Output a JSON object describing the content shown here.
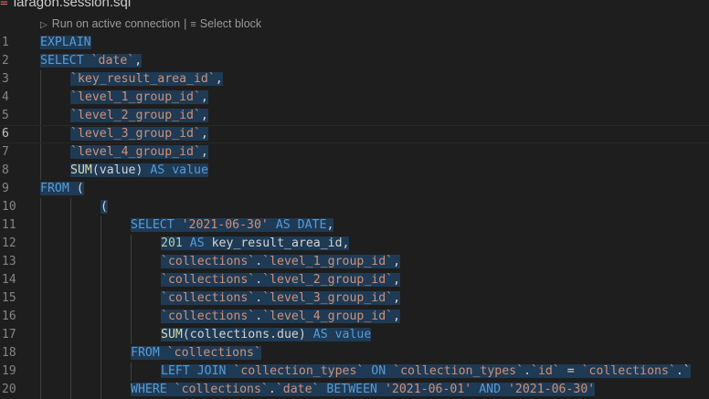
{
  "tab": {
    "filename": "laragon.session.sql"
  },
  "codelens": {
    "run_label": "Run on active connection",
    "separator": "|",
    "select_label": "Select block"
  },
  "lines": [
    {
      "n": "1",
      "indent": 0,
      "tokens": [
        {
          "t": "kw",
          "v": "EXPLAIN"
        }
      ]
    },
    {
      "n": "2",
      "indent": 0,
      "tokens": [
        {
          "t": "kw",
          "v": "SELECT"
        },
        {
          "t": "plain",
          "v": " "
        },
        {
          "t": "str",
          "v": "`date`"
        },
        {
          "t": "plain",
          "v": ","
        }
      ]
    },
    {
      "n": "3",
      "indent": 1,
      "tokens": [
        {
          "t": "str",
          "v": "`key_result_area_id`"
        },
        {
          "t": "plain",
          "v": ","
        }
      ]
    },
    {
      "n": "4",
      "indent": 1,
      "tokens": [
        {
          "t": "str",
          "v": "`level_1_group_id`"
        },
        {
          "t": "plain",
          "v": ","
        }
      ]
    },
    {
      "n": "5",
      "indent": 1,
      "tokens": [
        {
          "t": "str",
          "v": "`level_2_group_id`"
        },
        {
          "t": "plain",
          "v": ","
        }
      ]
    },
    {
      "n": "6",
      "indent": 1,
      "active": true,
      "tokens": [
        {
          "t": "str",
          "v": "`level_3_group_id`"
        },
        {
          "t": "plain",
          "v": ","
        }
      ]
    },
    {
      "n": "7",
      "indent": 1,
      "tokens": [
        {
          "t": "str",
          "v": "`level_4_group_id`"
        },
        {
          "t": "plain",
          "v": ","
        }
      ]
    },
    {
      "n": "8",
      "indent": 1,
      "tokens": [
        {
          "t": "fn",
          "v": "SUM"
        },
        {
          "t": "plain",
          "v": "(value) "
        },
        {
          "t": "kw",
          "v": "AS"
        },
        {
          "t": "plain",
          "v": " "
        },
        {
          "t": "kw",
          "v": "value"
        }
      ]
    },
    {
      "n": "9",
      "indent": 0,
      "tokens": [
        {
          "t": "kw",
          "v": "FROM"
        },
        {
          "t": "plain",
          "v": " ("
        }
      ]
    },
    {
      "n": "10",
      "indent": 2,
      "tokens": [
        {
          "t": "plain",
          "v": "("
        }
      ]
    },
    {
      "n": "11",
      "indent": 3,
      "tokens": [
        {
          "t": "kw",
          "v": "SELECT"
        },
        {
          "t": "plain",
          "v": " "
        },
        {
          "t": "str",
          "v": "'2021-06-30'"
        },
        {
          "t": "plain",
          "v": " "
        },
        {
          "t": "kw",
          "v": "AS"
        },
        {
          "t": "plain",
          "v": " "
        },
        {
          "t": "kw",
          "v": "DATE"
        },
        {
          "t": "plain",
          "v": ","
        }
      ]
    },
    {
      "n": "12",
      "indent": 4,
      "tokens": [
        {
          "t": "num",
          "v": "201"
        },
        {
          "t": "plain",
          "v": " "
        },
        {
          "t": "kw",
          "v": "AS"
        },
        {
          "t": "plain",
          "v": " key_result_area_id,"
        }
      ]
    },
    {
      "n": "13",
      "indent": 4,
      "tokens": [
        {
          "t": "str",
          "v": "`collections`"
        },
        {
          "t": "plain",
          "v": "."
        },
        {
          "t": "str",
          "v": "`level_1_group_id`"
        },
        {
          "t": "plain",
          "v": ","
        }
      ]
    },
    {
      "n": "14",
      "indent": 4,
      "tokens": [
        {
          "t": "str",
          "v": "`collections`"
        },
        {
          "t": "plain",
          "v": "."
        },
        {
          "t": "str",
          "v": "`level_2_group_id`"
        },
        {
          "t": "plain",
          "v": ","
        }
      ]
    },
    {
      "n": "15",
      "indent": 4,
      "tokens": [
        {
          "t": "str",
          "v": "`collections`"
        },
        {
          "t": "plain",
          "v": "."
        },
        {
          "t": "str",
          "v": "`level_3_group_id`"
        },
        {
          "t": "plain",
          "v": ","
        }
      ]
    },
    {
      "n": "16",
      "indent": 4,
      "tokens": [
        {
          "t": "str",
          "v": "`collections`"
        },
        {
          "t": "plain",
          "v": "."
        },
        {
          "t": "str",
          "v": "`level_4_group_id`"
        },
        {
          "t": "plain",
          "v": ","
        }
      ]
    },
    {
      "n": "17",
      "indent": 4,
      "tokens": [
        {
          "t": "fn",
          "v": "SUM"
        },
        {
          "t": "plain",
          "v": "(collections.due) "
        },
        {
          "t": "kw",
          "v": "AS"
        },
        {
          "t": "plain",
          "v": " "
        },
        {
          "t": "kw",
          "v": "value"
        }
      ]
    },
    {
      "n": "18",
      "indent": 3,
      "tokens": [
        {
          "t": "kw",
          "v": "FROM"
        },
        {
          "t": "plain",
          "v": " "
        },
        {
          "t": "str",
          "v": "`collections`"
        }
      ]
    },
    {
      "n": "19",
      "indent": 4,
      "tokens": [
        {
          "t": "kw",
          "v": "LEFT JOIN"
        },
        {
          "t": "plain",
          "v": " "
        },
        {
          "t": "str",
          "v": "`collection_types`"
        },
        {
          "t": "plain",
          "v": " "
        },
        {
          "t": "kw",
          "v": "ON"
        },
        {
          "t": "plain",
          "v": " "
        },
        {
          "t": "str",
          "v": "`collection_types`"
        },
        {
          "t": "plain",
          "v": "."
        },
        {
          "t": "str",
          "v": "`id`"
        },
        {
          "t": "plain",
          "v": " = "
        },
        {
          "t": "str",
          "v": "`collections`"
        },
        {
          "t": "plain",
          "v": ".`"
        }
      ]
    },
    {
      "n": "20",
      "indent": 3,
      "tokens": [
        {
          "t": "kw",
          "v": "WHERE"
        },
        {
          "t": "plain",
          "v": " "
        },
        {
          "t": "str",
          "v": "`collections`"
        },
        {
          "t": "plain",
          "v": "."
        },
        {
          "t": "str",
          "v": "`date`"
        },
        {
          "t": "plain",
          "v": " "
        },
        {
          "t": "kw",
          "v": "BETWEEN"
        },
        {
          "t": "plain",
          "v": " "
        },
        {
          "t": "str",
          "v": "'2021-06-01'"
        },
        {
          "t": "plain",
          "v": " "
        },
        {
          "t": "kw",
          "v": "AND"
        },
        {
          "t": "plain",
          "v": " "
        },
        {
          "t": "str",
          "v": "'2021-06-30'"
        }
      ]
    }
  ]
}
